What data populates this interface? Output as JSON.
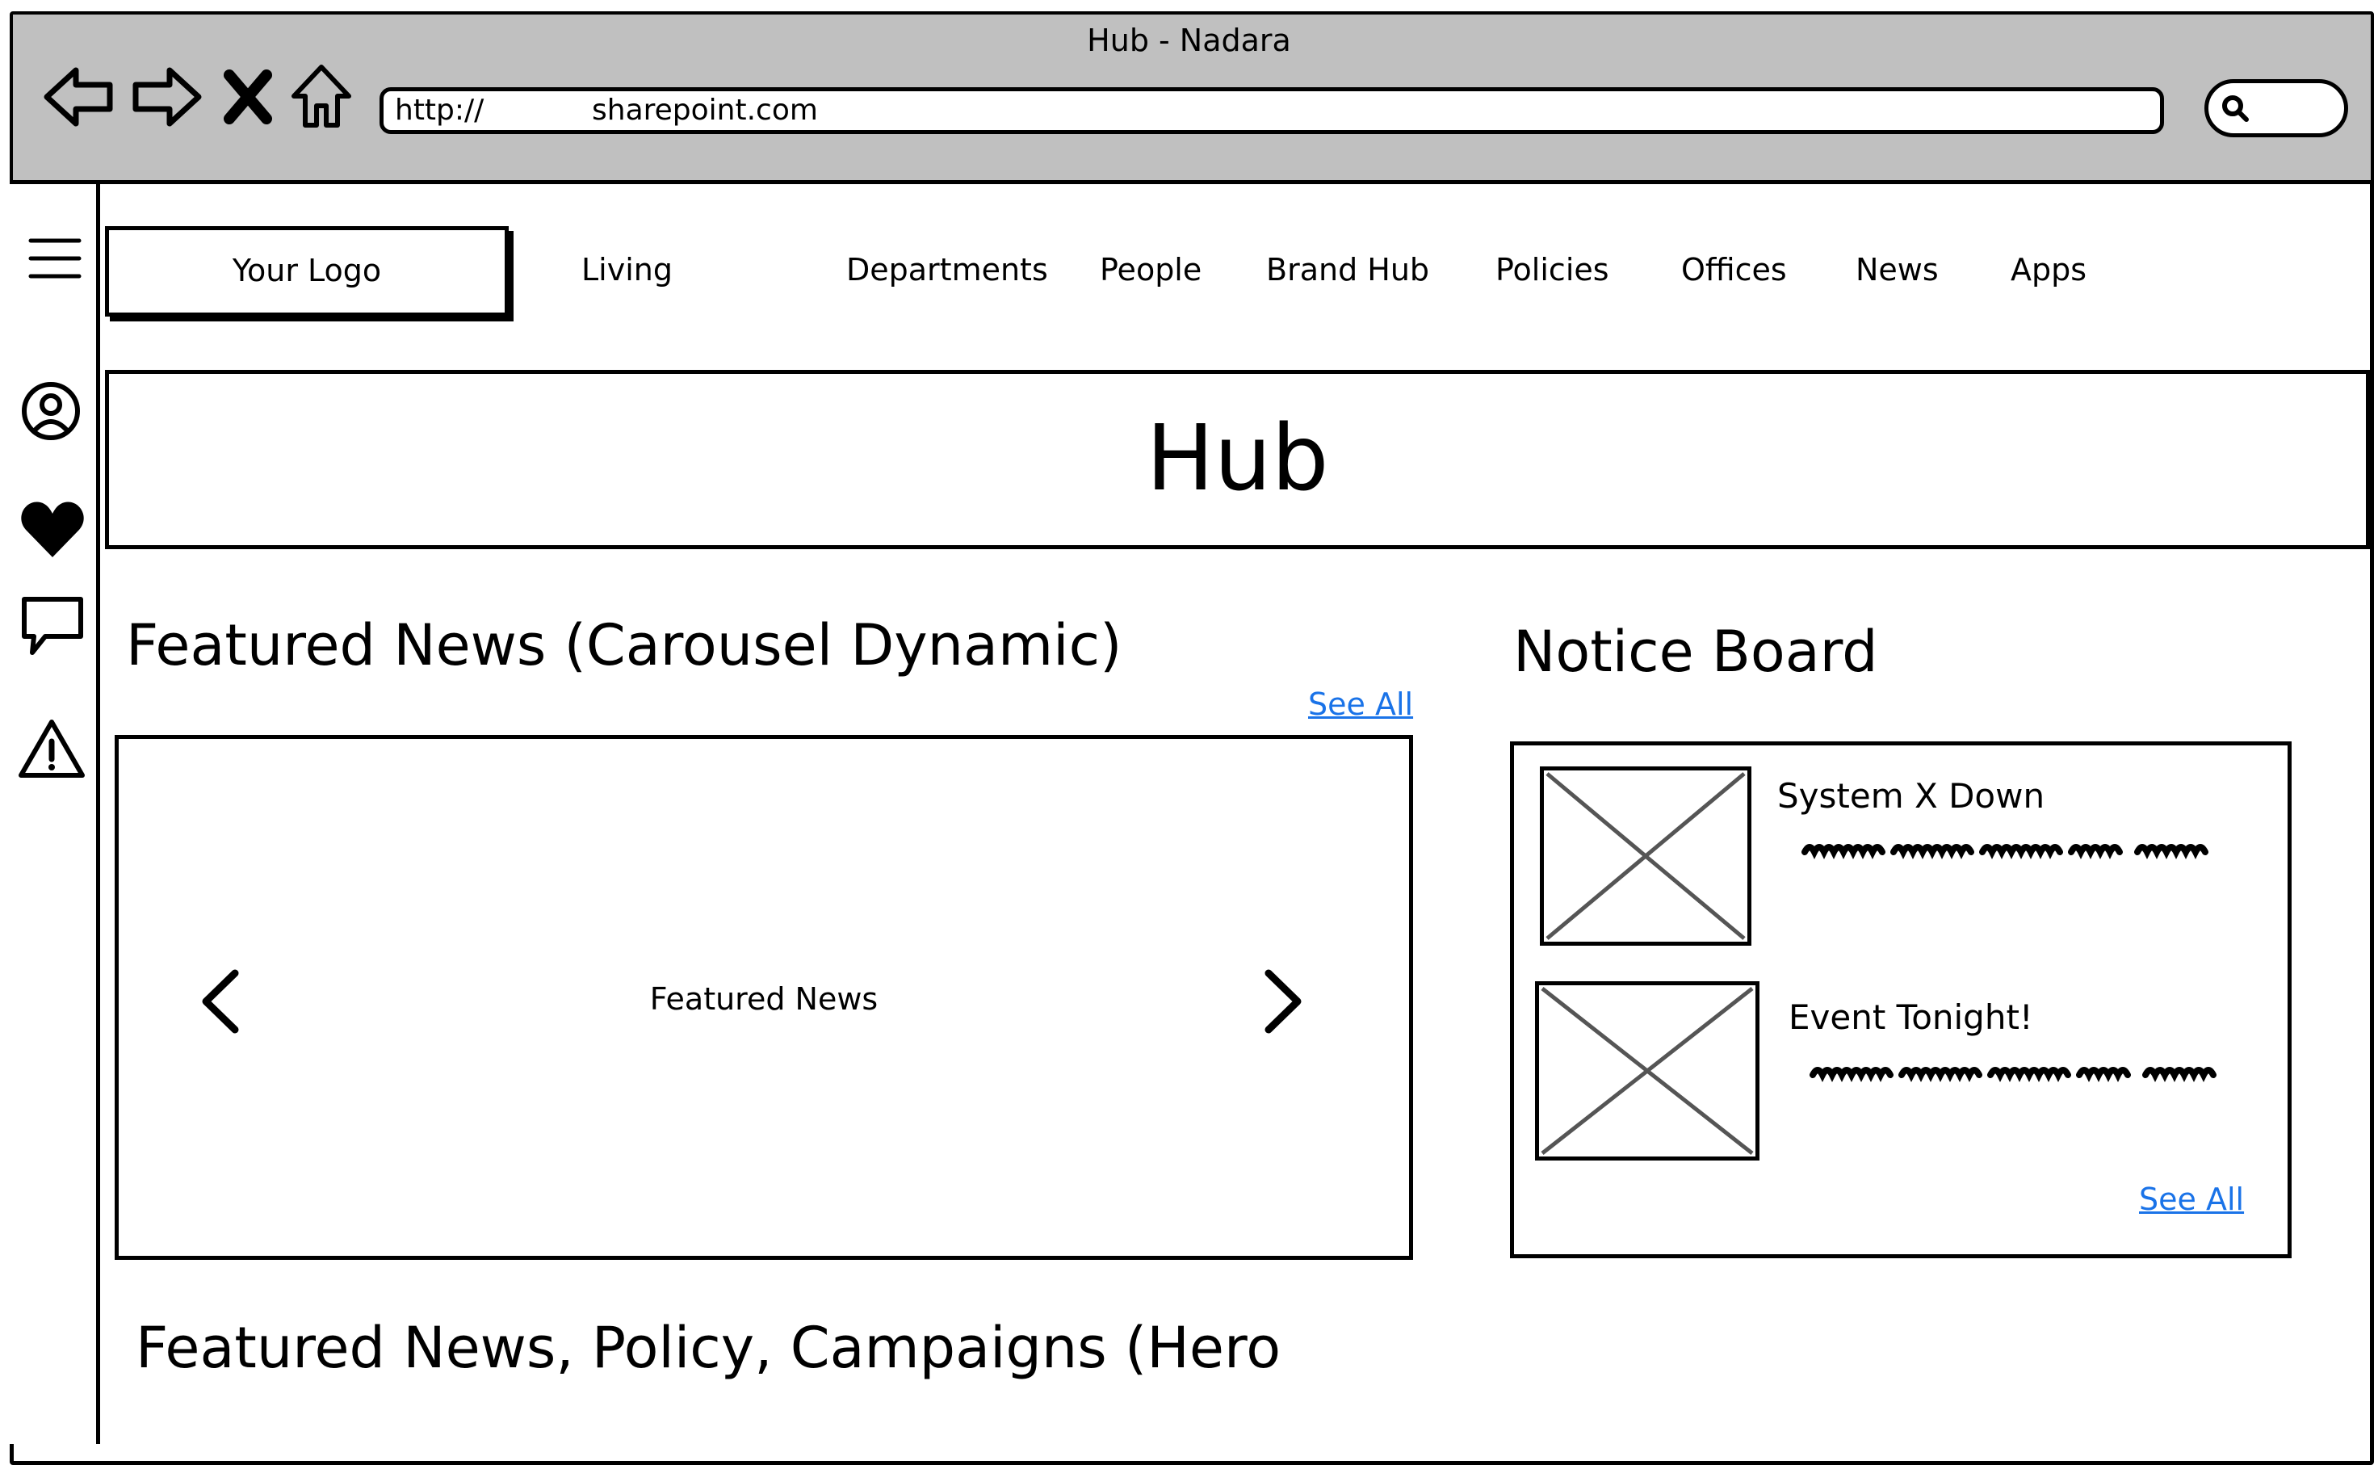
{
  "browser": {
    "title": "Hub - Nadara",
    "url_protocol": "http://",
    "url_host": "sharepoint.com",
    "icons": [
      "back-arrow-icon",
      "forward-arrow-icon",
      "close-icon",
      "home-icon",
      "search-icon"
    ]
  },
  "sidebar": {
    "icons": [
      "hamburger-menu-icon",
      "user-circle-icon",
      "heart-icon",
      "comment-icon",
      "warning-icon"
    ]
  },
  "header": {
    "logo": "Your Logo",
    "nav": [
      "Living",
      "Departments",
      "People",
      "Brand Hub",
      "Policies",
      "Offices",
      "News",
      "Apps"
    ]
  },
  "hero": {
    "title": "Hub"
  },
  "featured": {
    "title": "Featured News (Carousel Dynamic)",
    "see_all": "See All",
    "carousel_label": "Featured News"
  },
  "notice_board": {
    "title": "Notice Board",
    "items": [
      {
        "title": "System X Down"
      },
      {
        "title": "Event Tonight!"
      }
    ],
    "see_all": "See All"
  },
  "hero_section": {
    "title": "Featured News, Policy, Campaigns (Hero"
  }
}
